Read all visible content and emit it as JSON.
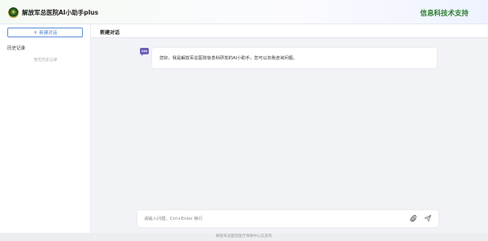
{
  "header": {
    "app_title": "解放军总医院AI小助手plus",
    "support_text": "信息科技术支持",
    "icons": {
      "logo": "hospital-emblem-icon"
    }
  },
  "sidebar": {
    "new_chat_plus": "+",
    "new_chat_label": "新建对话",
    "history_title": "历史记录",
    "history_empty": "暂无历史记录"
  },
  "chat": {
    "title": "新建对话",
    "messages": [
      {
        "role": "assistant",
        "text": "您好，我是解放军总医院信息科研发的AI小助手，您可以向我咨询问题。"
      }
    ]
  },
  "input": {
    "placeholder": "请输入问题，Ctrl+Enter 换行",
    "value": "",
    "icons": {
      "attach": "paperclip-icon",
      "send": "send-icon"
    }
  },
  "footer": {
    "text": "解放军总医院医疗保障中心信息科"
  },
  "colors": {
    "accent_green": "#2e7d32",
    "accent_blue": "#4a7fd0",
    "bot_avatar": "#6f5fb8"
  }
}
